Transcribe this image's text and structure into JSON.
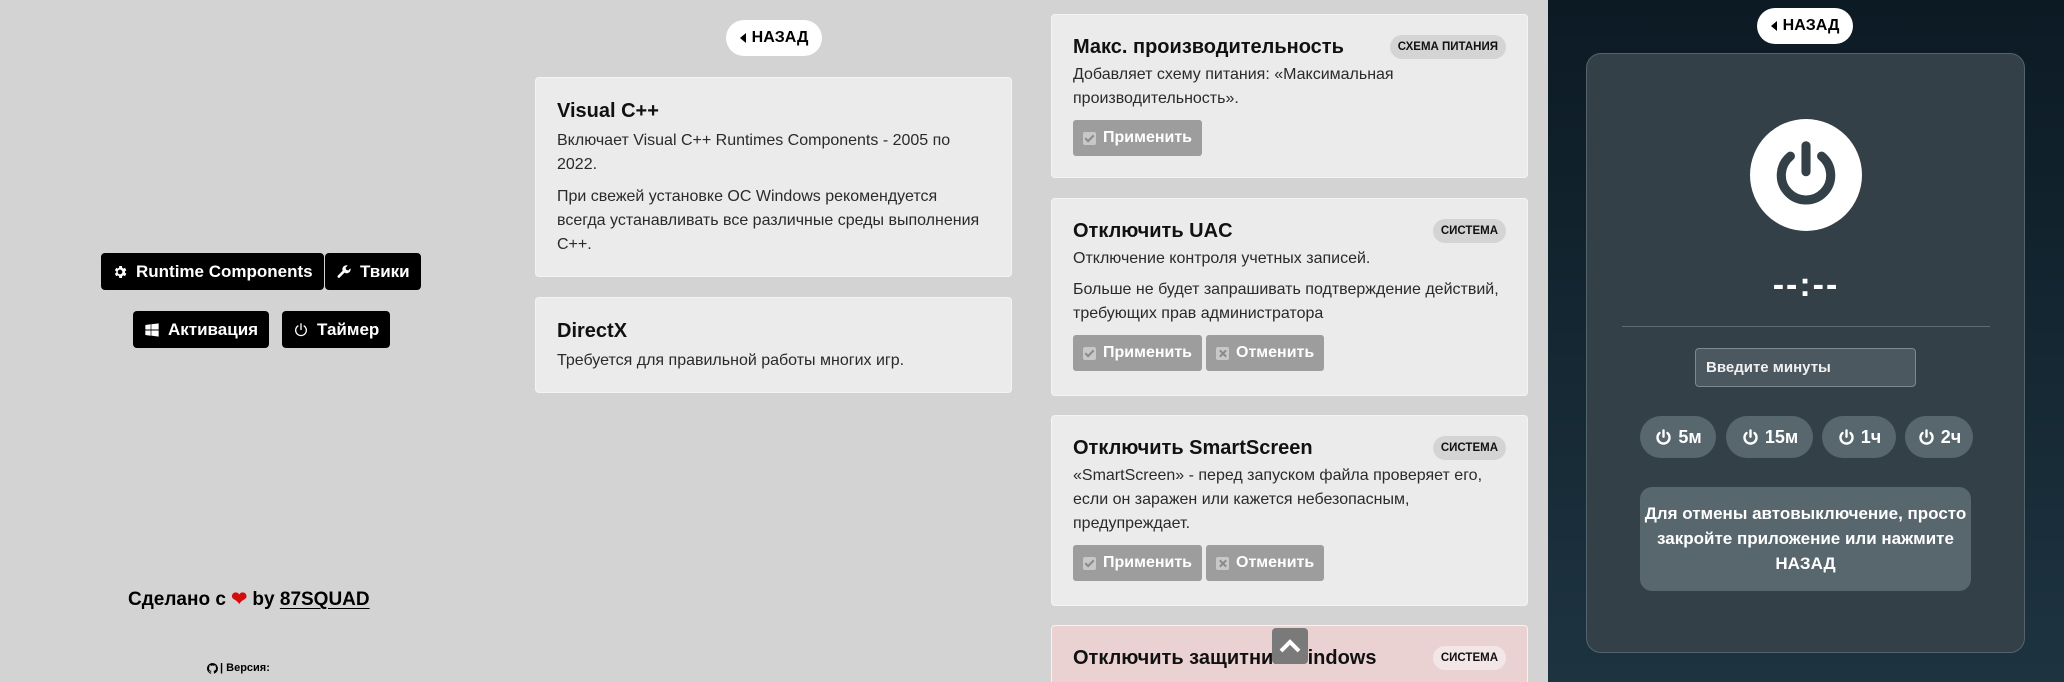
{
  "nav": {
    "runtime_label": "Runtime Components",
    "tweaks_label": "Твики",
    "activation_label": "Активация",
    "timer_label": "Таймер"
  },
  "footer": {
    "made_with": "Сделано с",
    "by": "by",
    "brand": "87SQUAD",
    "version": "| Версия:"
  },
  "runtime_section": {
    "back_label": "НАЗАД",
    "cards": [
      {
        "title": "Visual C++",
        "lines": [
          "Включает Visual C++ Runtimes Components - 2005 по 2022.",
          "При свежей установке ОС Windows рекомендуется всегда устанавливать все различные среды выполнения С++."
        ]
      },
      {
        "title": "DirectX",
        "lines": [
          "Требуется для правильной работы многих игр."
        ]
      }
    ]
  },
  "tweaks": [
    {
      "title": "Макс. производительность",
      "badge": "СХЕМА ПИТАНИЯ",
      "desc": [
        "Добавляет схему питания: «Максимальная производительность»."
      ],
      "apply_label": "Применить"
    },
    {
      "title": "Отключить UAC",
      "badge": "СИСТЕМА",
      "desc": [
        "Отключение контроля учетных записей.",
        "Больше не будет запрашивать подтверждение действий, требующих прав администратора"
      ],
      "apply_label": "Применить",
      "cancel_label": "Отменить"
    },
    {
      "title": "Отключить SmartScreen",
      "badge": "СИСТЕМА",
      "desc": [
        "«SmartScreen» - перед запуском файла проверяет его, если он заражен или кажется небезопасным, предупреждает."
      ],
      "apply_label": "Применить",
      "cancel_label": "Отменить"
    },
    {
      "title": "Отключить защитник Windows",
      "badge": "СИСТЕМА"
    }
  ],
  "timer": {
    "back_label": "НАЗАД",
    "display": "--:--",
    "input_placeholder": "Введите минуты",
    "presets": [
      "5м",
      "15м",
      "1ч",
      "2ч"
    ],
    "note_text": "Для отмены автовыключение, просто закройте приложение или нажмите",
    "note_bold": "НАЗАД"
  },
  "colors": {
    "page_bg": "#d3d3d3",
    "card_bg": "#ebebeb",
    "nav_button_bg": "#000000",
    "button_disabled": "#9d9d9d",
    "heart": "#d30d0d",
    "timer_panel": "#1d3440",
    "timer_box": "#334048"
  },
  "icons": [
    "gear-icon",
    "wrench-icon",
    "windows-icon",
    "power-icon",
    "heart-icon",
    "github-icon",
    "chevron-left-icon",
    "chevron-up-icon",
    "check-icon",
    "x-icon"
  ]
}
